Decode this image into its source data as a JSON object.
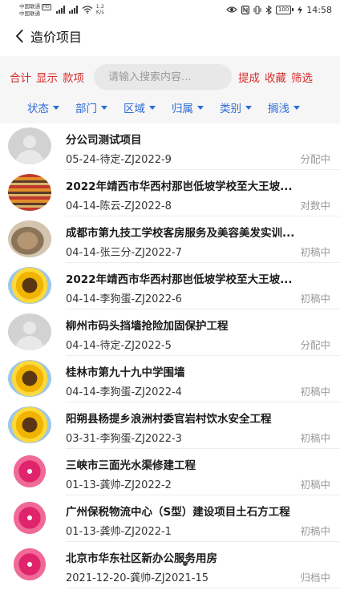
{
  "status_bar": {
    "carrier1": "中国联通",
    "carrier2": "中国联通",
    "hd": "HD",
    "speed_value": "1.2",
    "speed_unit": "K/s",
    "battery": "100",
    "time": "14:58"
  },
  "header": {
    "title": "造价项目"
  },
  "toolbar": {
    "total": "合计",
    "display": "显示",
    "payment": "款项",
    "search_placeholder": "请输入搜索内容...",
    "submit": "提成",
    "favorite": "收藏",
    "filter": "筛选"
  },
  "filters": [
    "状态",
    "部门",
    "区域",
    "归属",
    "类别",
    "搁浅"
  ],
  "projects": [
    {
      "title": "分公司测试项目",
      "meta": "05-24-待定-ZJ2022-9",
      "status": "分配中",
      "avatar": "placeholder"
    },
    {
      "title": "2022年靖西市华西村那岜低坡学校至大王坡...",
      "meta": "04-14-陈云-ZJ2022-8",
      "status": "对数中",
      "avatar": "carpet"
    },
    {
      "title": "成都市第九技工学校客房服务及美容美发实训...",
      "meta": "04-14-张三分-ZJ2022-7",
      "status": "初稿中",
      "avatar": "cat"
    },
    {
      "title": "2022年靖西市华西村那岜低坡学校至大王坡...",
      "meta": "04-14-李狗蛋-ZJ2022-6",
      "status": "初稿中",
      "avatar": "sunflower"
    },
    {
      "title": "柳州市码头挡墙抢险加固保护工程",
      "meta": "04-14-待定-ZJ2022-5",
      "status": "分配中",
      "avatar": "placeholder"
    },
    {
      "title": "桂林市第九十九中学围墙",
      "meta": "04-14-李狗蛋-ZJ2022-4",
      "status": "初稿中",
      "avatar": "sunflower"
    },
    {
      "title": "阳朔县杨提乡浪洲村委官岩村饮水安全工程",
      "meta": "03-31-李狗蛋-ZJ2022-3",
      "status": "初稿中",
      "avatar": "sunflower"
    },
    {
      "title": "三峡市三面光水渠修建工程",
      "meta": "01-13-龚帅-ZJ2022-2",
      "status": "初稿中",
      "avatar": "flower"
    },
    {
      "title": "广州保税物流中心（S型）建设项目土石方工程",
      "meta": "01-13-龚帅-ZJ2022-1",
      "status": "初稿中",
      "avatar": "flower"
    },
    {
      "title": "北京市华东社区新办公服务用房",
      "meta": "2021-12-20-龚帅-ZJ2021-15",
      "status": "归档中",
      "avatar": "flower"
    }
  ]
}
